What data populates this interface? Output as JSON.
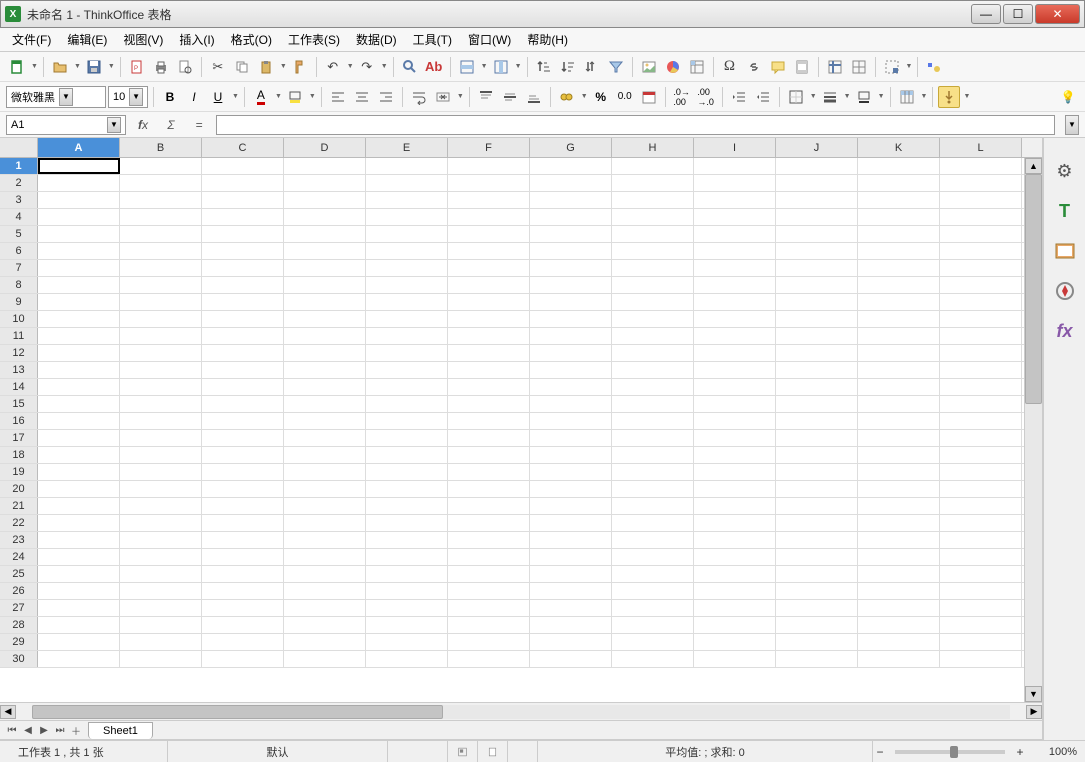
{
  "window": {
    "title": "未命名 1 - ThinkOffice 表格",
    "app_icon_letter": "X"
  },
  "menu": {
    "file": "文件(F)",
    "edit": "编辑(E)",
    "view": "视图(V)",
    "insert": "插入(I)",
    "format": "格式(O)",
    "sheet": "工作表(S)",
    "data": "数据(D)",
    "tools": "工具(T)",
    "window": "窗口(W)",
    "help": "帮助(H)"
  },
  "format_bar": {
    "font_name": "微软雅黑",
    "font_size": "10"
  },
  "formulabar": {
    "cell_ref": "A1",
    "formula_value": ""
  },
  "columns": [
    "A",
    "B",
    "C",
    "D",
    "E",
    "F",
    "G",
    "H",
    "I",
    "J",
    "K",
    "L"
  ],
  "rows": [
    1,
    2,
    3,
    4,
    5,
    6,
    7,
    8,
    9,
    10,
    11,
    12,
    13,
    14,
    15,
    16,
    17,
    18,
    19,
    20,
    21,
    22,
    23,
    24,
    25,
    26,
    27,
    28,
    29,
    30
  ],
  "active_cell": {
    "col": "A",
    "row": 1
  },
  "tabs": {
    "sheet1": "Sheet1"
  },
  "statusbar": {
    "sheet_info": "工作表 1 , 共 1 张",
    "default_style": "默认",
    "calc_info": "平均值: ; 求和: 0",
    "zoom": "100%"
  },
  "percent_label": "%",
  "decimal_label": "0.0",
  "omega_label": "Ω"
}
